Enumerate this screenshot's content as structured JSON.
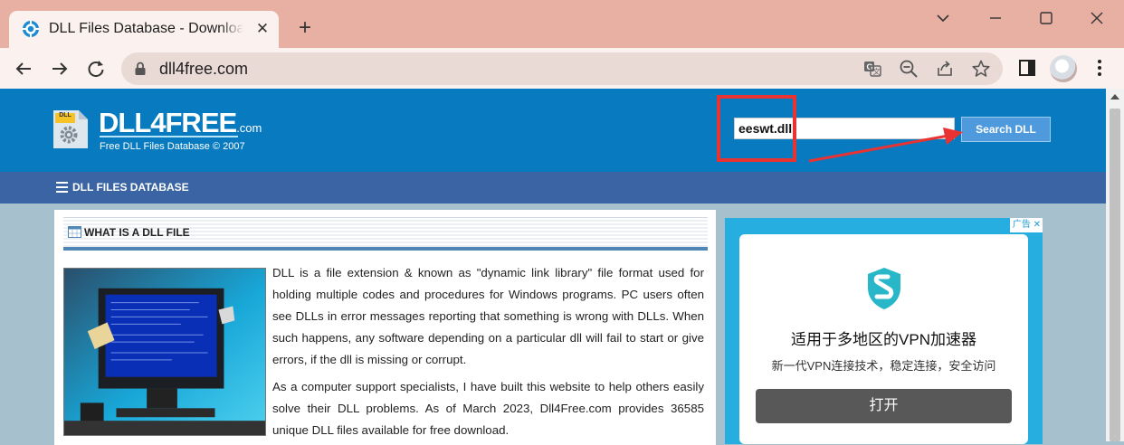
{
  "browser": {
    "tab_title": "DLL Files Database - Download",
    "tab_close": "✕",
    "new_tab": "+",
    "url": "dll4free.com"
  },
  "site": {
    "logo_badge": "DLL",
    "logo_name": "DLL4FREE",
    "logo_suffix": ".com",
    "tagline": "Free DLL Files Database © 2007",
    "search_value": "eeswt.dll",
    "search_button": "Search DLL",
    "nav_label": "DLL FILES DATABASE"
  },
  "article": {
    "section_title": "WHAT IS A DLL FILE",
    "paragraph1": "DLL is a file extension & known as \"dynamic link library\" file format used for holding multiple codes and procedures for Windows programs. PC users often see DLLs in error messages reporting that something is wrong with DLLs. When such happens, any software depending on a particular dll will fail to start or give errors, if the dll is missing or corrupt.",
    "paragraph2": "As a computer support specialists, I have built this website to help others easily solve their DLL problems. As of March 2023, Dll4Free.com provides 36585 unique DLL files available for free download."
  },
  "ad": {
    "tag": "广告",
    "close": "✕",
    "title": "适用于多地区的VPN加速器",
    "subtitle": "新一代VPN连接技术，稳定连接，安全访问",
    "button": "打开"
  },
  "colors": {
    "header_blue": "#087bc0",
    "nav_blue": "#3a64a3",
    "annotation_red": "#e93232",
    "ad_blue": "#26aee0"
  }
}
